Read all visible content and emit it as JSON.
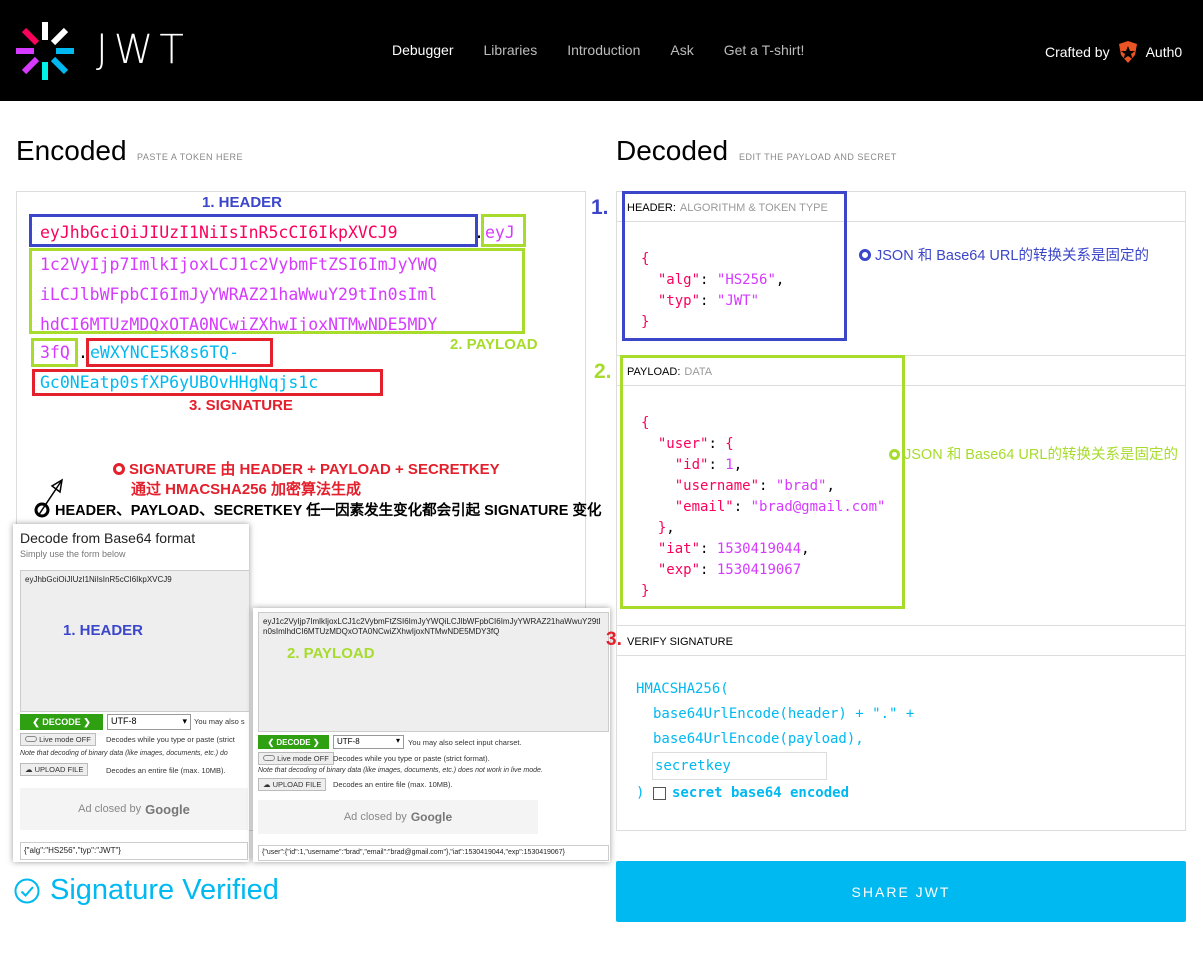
{
  "nav": {
    "logo_text": "JWT",
    "links": [
      "Debugger",
      "Libraries",
      "Introduction",
      "Ask",
      "Get a T-shirt!"
    ],
    "crafted_by": "Crafted by",
    "brand": "Auth0"
  },
  "encoded": {
    "title": "Encoded",
    "subtitle": "PASTE A TOKEN HERE",
    "token": {
      "header": "eyJhbGciOiJIUzI1NiIsInR5cCI6IkpXVCJ9",
      "dot": ".",
      "payload_line1": "eyJ",
      "payload_line2": "1c2VyIjp7ImlkIjoxLCJ1c2VybmFtZSI6ImJyYWQ",
      "payload_line3": "iLCJlbWFpbCI6ImJyYWRAZ21haWwuY29tIn0sIml",
      "payload_line4": "hdCI6MTUzMDQxOTA0NCwiZXhwIjoxNTMwNDE5MDY",
      "payload_line5": "3fQ",
      "signature_line1": "eWXYNCE5K8s6TQ-",
      "signature_line2": "Gc0NEatp0sfXP6yUBOvHHgNqjs1c"
    },
    "labels": {
      "header": "1. HEADER",
      "payload": "2. PAYLOAD",
      "signature": "3. SIGNATURE"
    },
    "notes": {
      "sig_line1": "SIGNATURE 由 HEADER + PAYLOAD + SECRETKEY",
      "sig_line2": "通过 HMACSHA256 加密算法生成",
      "change": "HEADER、PAYLOAD、SECRETKEY 任一因素发生变化都会引起 SIGNATURE 变化"
    }
  },
  "decoded": {
    "title": "Decoded",
    "subtitle": "EDIT THE PAYLOAD AND SECRET",
    "header_label": "HEADER:",
    "header_sub": "ALGORITHM & TOKEN TYPE",
    "payload_label": "PAYLOAD:",
    "payload_sub": "DATA",
    "verify_label": "VERIFY SIGNATURE",
    "num1": "1.",
    "num2": "2.",
    "num3": "3.",
    "note_header": "JSON 和 Base64 URL的转换关系是固定的",
    "note_payload": "JSON 和 Base64 URL的转换关系是固定的",
    "header_json": {
      "alg": "HS256",
      "typ": "JWT"
    },
    "payload_json": {
      "id": "1",
      "username": "brad",
      "email": "brad@gmail.com",
      "iat": "1530419044",
      "exp": "1530419067"
    },
    "verify": {
      "fn": "HMACSHA256(",
      "line2": "base64UrlEncode(header) + \".\" +",
      "line3": "base64UrlEncode(payload),",
      "secret": "secretkey",
      "close": ")",
      "encoded_label": "secret base64 encoded"
    }
  },
  "share_button": "SHARE JWT",
  "verified_text": "Signature Verified",
  "b64_left": {
    "title": "Decode from Base64 format",
    "subtitle": "Simply use the form below",
    "input": "eyJhbGciOiJIUzI1NiIsInR5cCI6IkpXVCJ9",
    "label": "1. HEADER",
    "decode": "❮ DECODE ❯",
    "charset": "UTF-8",
    "also": "You may also s",
    "live": "Live mode OFF",
    "live_desc": "Decodes while you type or paste (strict",
    "note": "Note that decoding of binary data (like images, documents, etc.) do",
    "upload": "UPLOAD FILE",
    "upload_desc": "Decodes an entire file (max. 10MB).",
    "ad": "Ad closed by",
    "google": "Google",
    "result": "{\"alg\":\"HS256\",\"typ\":\"JWT\"}"
  },
  "b64_right": {
    "input": "eyJ1c2VyIjp7ImlkIjoxLCJ1c2VybmFtZSI6ImJyYWQiLCJlbWFpbCI6ImJyYWRAZ21haWwuY29tIn0sImlhdCI6MTUzMDQxOTA0NCwiZXhwIjoxNTMwNDE5MDY3fQ",
    "label": "2. PAYLOAD",
    "decode": "❮ DECODE ❯",
    "charset": "UTF-8",
    "also": "You may also select input charset.",
    "live": "Live mode OFF",
    "live_desc": "Decodes while you type or paste (strict format).",
    "note": "Note that decoding of binary data (like images, documents, etc.) does not work in live mode.",
    "upload": "UPLOAD FILE",
    "upload_desc": "Decodes an entire file (max. 10MB).",
    "ad": "Ad closed by",
    "google": "Google",
    "result": "{\"user\":{\"id\":1,\"username\":\"brad\",\"email\":\"brad@gmail.com\"},\"iat\":1530419044,\"exp\":1530419067}"
  }
}
